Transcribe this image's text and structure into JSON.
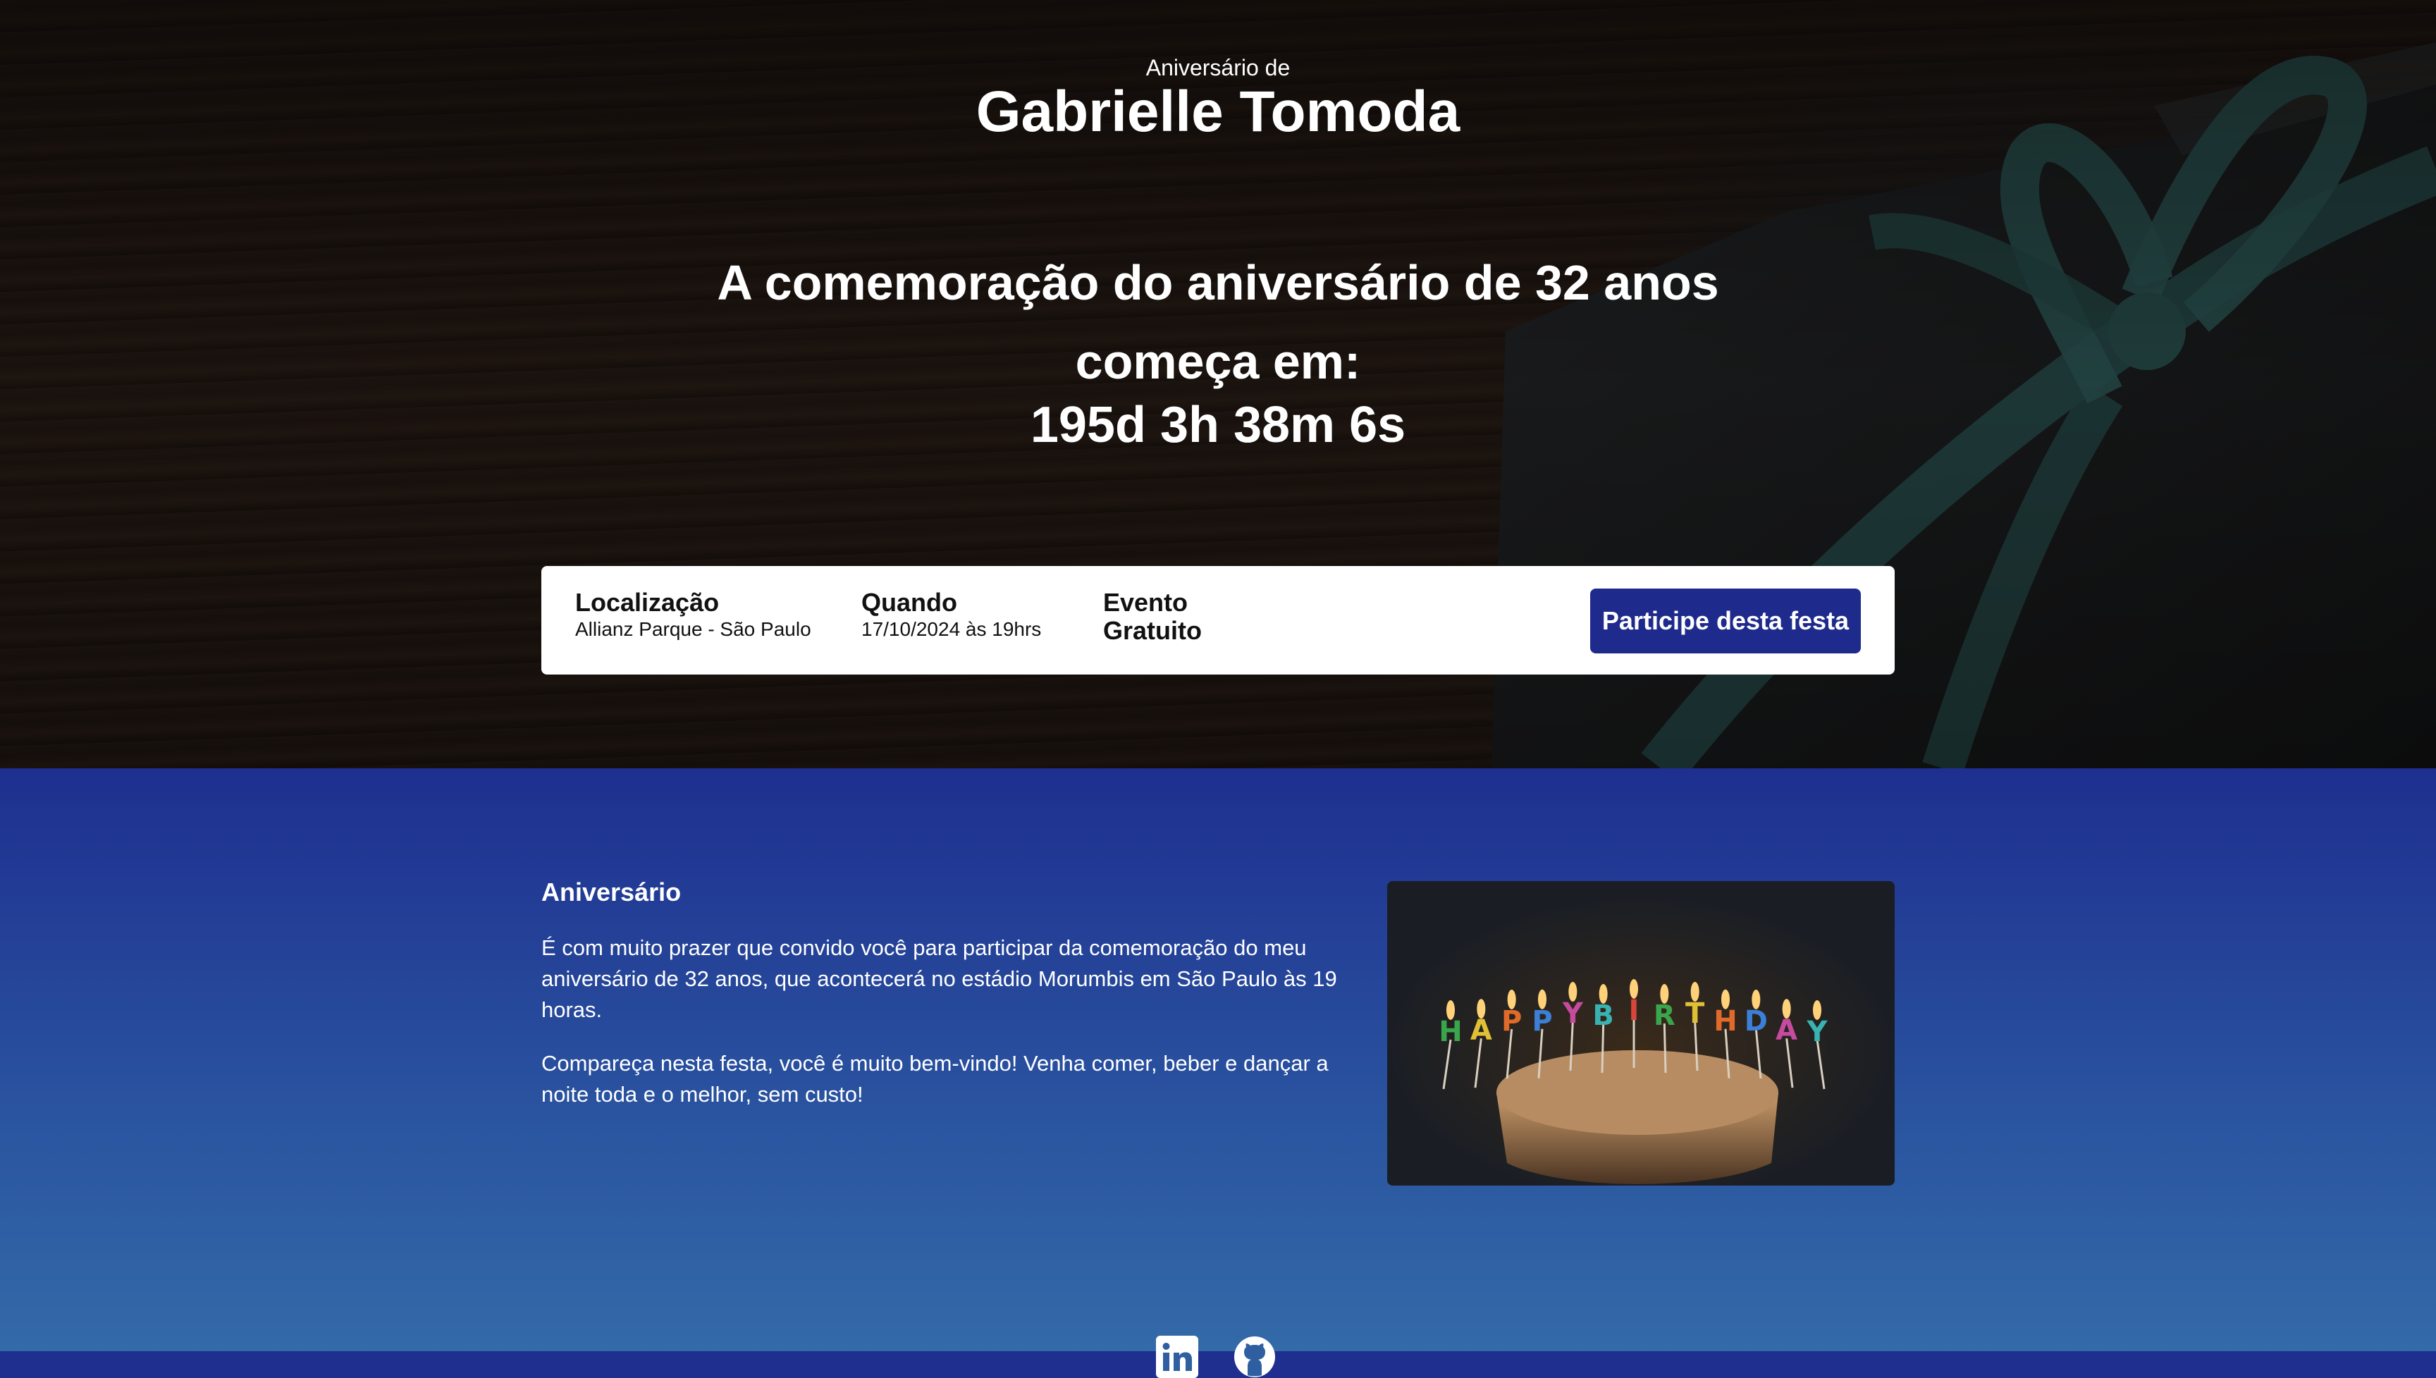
{
  "hero": {
    "kicker": "Aniversário de",
    "name": "Gabrielle Tomoda",
    "headline": "A comemoração do aniversário de 32 anos começa em:",
    "countdown": "195d 3h 38m 6s"
  },
  "event_card": {
    "location_label": "Localização",
    "location_value": "Allianz Parque - São Paulo",
    "when_label": "Quando",
    "when_value": "17/10/2024 às 19hrs",
    "event_label": "Evento Gratuito",
    "join_button": "Participe desta festa"
  },
  "about": {
    "title": "Aniversário",
    "paragraph1": "É com muito prazer que convido você para participar da comemoração do meu aniversário de 32 anos, que acontecerá no estádio Morumbis em São Paulo às 19 horas.",
    "paragraph2": "Compareça nesta festa, você é muito bem-vindo! Venha comer, beber e dançar a noite toda e o melhor, sem custo!",
    "image_candles": [
      "H",
      "A",
      "P",
      "P",
      "Y",
      "B",
      "I",
      "R",
      "T",
      "H",
      "D",
      "A",
      "Y"
    ]
  },
  "socials": {
    "icons": [
      "linkedin-icon",
      "github-icon"
    ]
  },
  "colors": {
    "primary": "#1e2b8c",
    "ribbon": "#2f5c5a"
  }
}
